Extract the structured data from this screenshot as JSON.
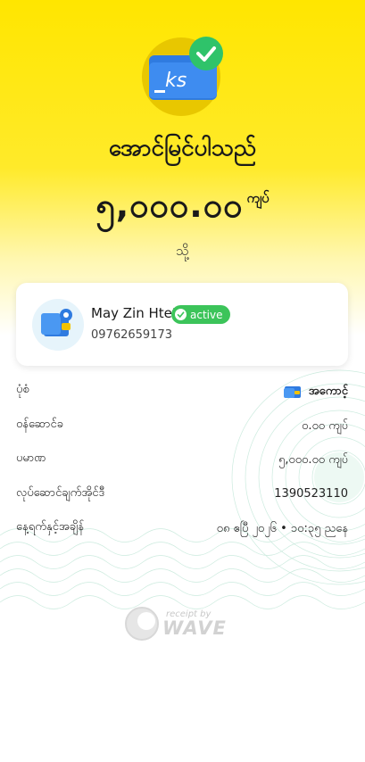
{
  "status": {
    "title": "အောင်မြင်ပါသည်",
    "amount": "၅,၀၀၀.၀၀",
    "amount_unit": "ကျပ်",
    "to_label": "သို့"
  },
  "hero_icon": {
    "text": "ks"
  },
  "recipient": {
    "name": "May Zin Htet",
    "badge": "active",
    "phone": "09762659173"
  },
  "details": [
    {
      "label": "ပုံစံ",
      "value": "အကောင့်",
      "icon": "wallet-icon"
    },
    {
      "label": "ဝန်ဆောင်ခ",
      "value": "၀.၀၀ ကျပ်"
    },
    {
      "label": "ပမာဏ",
      "value": "၅,၀၀၀.၀၀ ကျပ်"
    },
    {
      "label": "လုပ်ဆောင်ချက်အိုင်ဒီ",
      "value": "1390523110"
    },
    {
      "label": "နေ့ရက်နှင့်အချိန်",
      "value": "၀၈ ဧပြီ ၂၀၂၆ • ၁၀:၃၅ ညနေ"
    }
  ],
  "footer": {
    "small": "receipt by",
    "brand": "WAVE"
  },
  "colors": {
    "brand_yellow": "#FFE600",
    "active_green": "#3CC45A",
    "wallet_blue": "#2F7BE0"
  }
}
